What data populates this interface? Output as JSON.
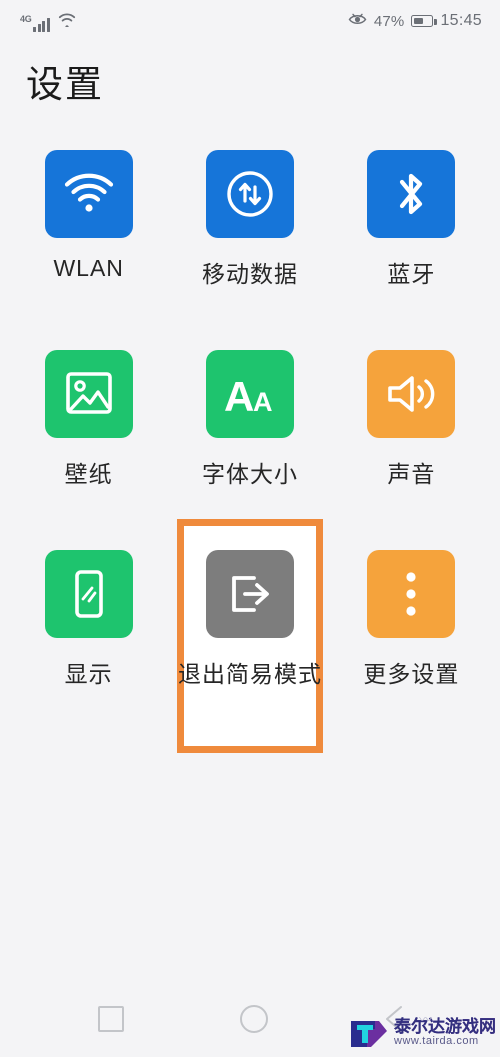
{
  "statusbar": {
    "network_type": "4G",
    "signal_icon": "signal-bars-icon",
    "wifi_icon": "wifi-icon",
    "eye_comfort_icon": "eye-comfort-icon",
    "battery_percent": "47%",
    "battery_icon": "battery-icon",
    "time": "15:45"
  },
  "header": {
    "title": "设置"
  },
  "grid": {
    "items": [
      {
        "label": "WLAN",
        "icon": "wifi-icon",
        "tile_color": "#1675d9",
        "icon_color": "#ffffff"
      },
      {
        "label": "移动数据",
        "icon": "mobile-data-icon",
        "tile_color": "#1675d9",
        "icon_color": "#ffffff"
      },
      {
        "label": "蓝牙",
        "icon": "bluetooth-icon",
        "tile_color": "#1675d9",
        "icon_color": "#ffffff"
      },
      {
        "label": "壁纸",
        "icon": "wallpaper-icon",
        "tile_color": "#1ec46e",
        "icon_color": "#ffffff"
      },
      {
        "label": "字体大小",
        "icon": "font-size-icon",
        "tile_color": "#1ec46e",
        "icon_color": "#ffffff"
      },
      {
        "label": "声音",
        "icon": "speaker-icon",
        "tile_color": "#f5a33c",
        "icon_color": "#ffffff"
      },
      {
        "label": "显示",
        "icon": "display-icon",
        "tile_color": "#1ec46e",
        "icon_color": "#ffffff"
      },
      {
        "label": "退出简易模式",
        "icon": "exit-icon",
        "tile_color": "#7d7d7d",
        "icon_color": "#ffffff"
      },
      {
        "label": "更多设置",
        "icon": "more-dots-icon",
        "tile_color": "#f5a33c",
        "icon_color": "#ffffff"
      }
    ],
    "highlight_index": 7,
    "highlight_color": "#ef8a3c"
  },
  "navbar": {
    "recent_label": "recent-apps-icon",
    "home_label": "home-icon",
    "back_label": "back-icon"
  },
  "watermark": {
    "site_name": "泰尔达游戏网",
    "url": "www.tairda.com"
  }
}
